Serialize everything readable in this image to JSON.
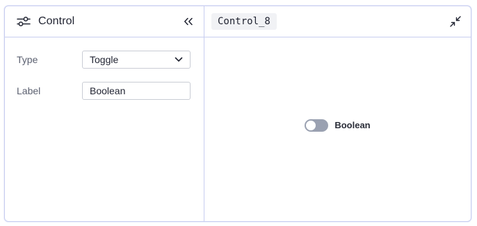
{
  "left_panel": {
    "title": "Control",
    "header_icon": "sliders-icon",
    "collapse_icon": "chevrons-left-icon"
  },
  "form": {
    "type_label": "Type",
    "type_value": "Toggle",
    "label_label": "Label",
    "label_value": "Boolean"
  },
  "right_panel": {
    "name": "Control_8",
    "minimize_icon": "minimize-icon"
  },
  "preview": {
    "toggle_label": "Boolean",
    "toggle_checked": false
  },
  "colors": {
    "border": "#c7cdf0",
    "toggle_off": "#9aa1b1",
    "chip_bg": "#f1f2f5"
  }
}
